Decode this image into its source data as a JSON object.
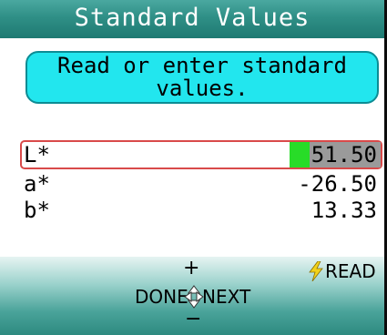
{
  "header": {
    "title": "Standard Values"
  },
  "instruction": {
    "text": "Read or enter standard\nvalues."
  },
  "rows": [
    {
      "label": "L*",
      "value": "51.50",
      "selected": true
    },
    {
      "label": "a*",
      "value": "-26.50",
      "selected": false
    },
    {
      "label": "b*",
      "value": "13.33",
      "selected": false
    }
  ],
  "footer": {
    "plus": "+",
    "minus": "−",
    "done_label": "DONE",
    "next_label": "NEXT",
    "read_label": "READ",
    "read_icon": "lightning-bolt-icon",
    "nav_icon": "dpad-arrows-icon"
  },
  "colors": {
    "title_bar": "#2f8f86",
    "instruction_bg": "#22e6ee",
    "selection_border": "#d94a4a",
    "cursor": "#28dc28",
    "value_highlight": "#9a9a9a",
    "bolt": "#f2d21a"
  }
}
